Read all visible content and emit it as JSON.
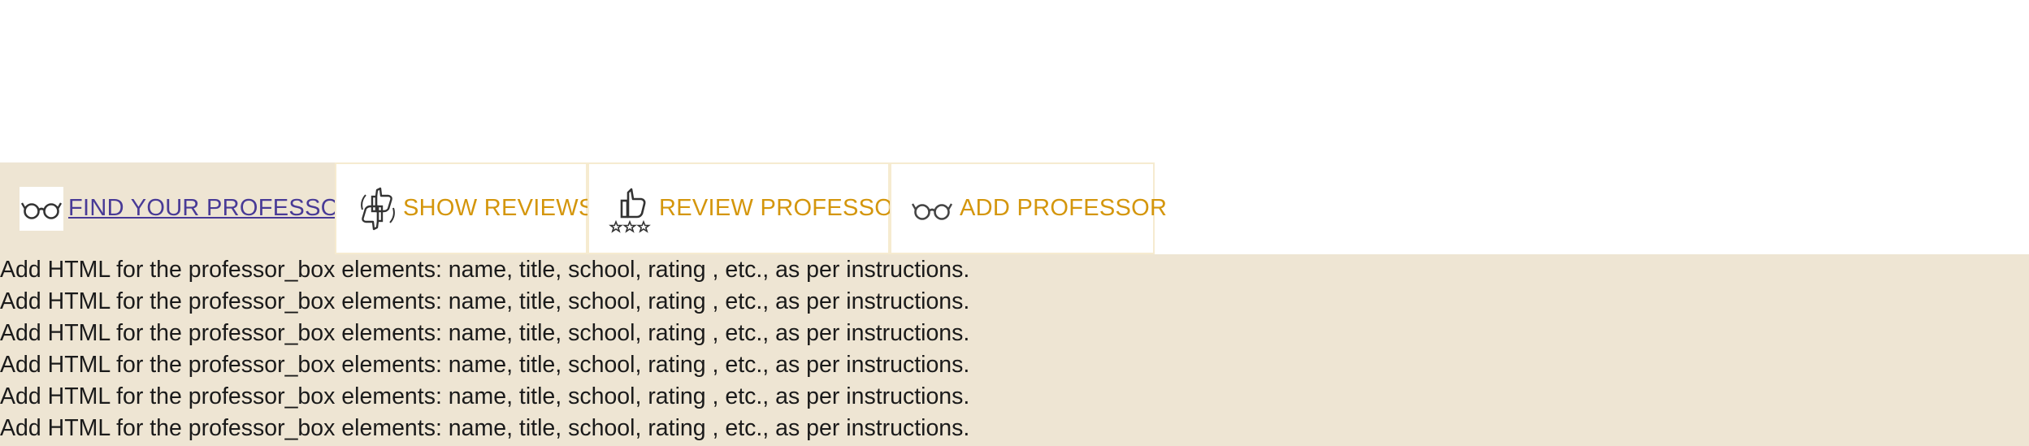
{
  "tabs": {
    "find": {
      "label": "FIND YOUR PROFESSOR",
      "icon": "glasses-icon",
      "active": true
    },
    "show": {
      "label": "SHOW REVIEWS",
      "icon": "thumbs-up-down-icon",
      "active": false
    },
    "review": {
      "label": "REVIEW PROFESSOR",
      "icon": "thumbs-up-stars-icon",
      "active": false
    },
    "add": {
      "label": "ADD PROFESSOR",
      "icon": "glasses-icon",
      "active": false
    }
  },
  "content": {
    "lines": [
      "Add HTML for the professor_box elements: name, title, school, rating , etc., as per instructions.",
      "Add HTML for the professor_box elements: name, title, school, rating , etc., as per instructions.",
      "Add HTML for the professor_box elements: name, title, school, rating , etc., as per instructions.",
      "Add HTML for the professor_box elements: name, title, school, rating , etc., as per instructions.",
      "Add HTML for the professor_box elements: name, title, school, rating , etc., as per instructions.",
      "Add HTML for the professor_box elements: name, title, school, rating , etc., as per instructions."
    ]
  },
  "colors": {
    "accent": "#d4960c",
    "active_link": "#483a96",
    "panel_bg": "#eee5d3",
    "tab_border": "#f6ebd0"
  }
}
